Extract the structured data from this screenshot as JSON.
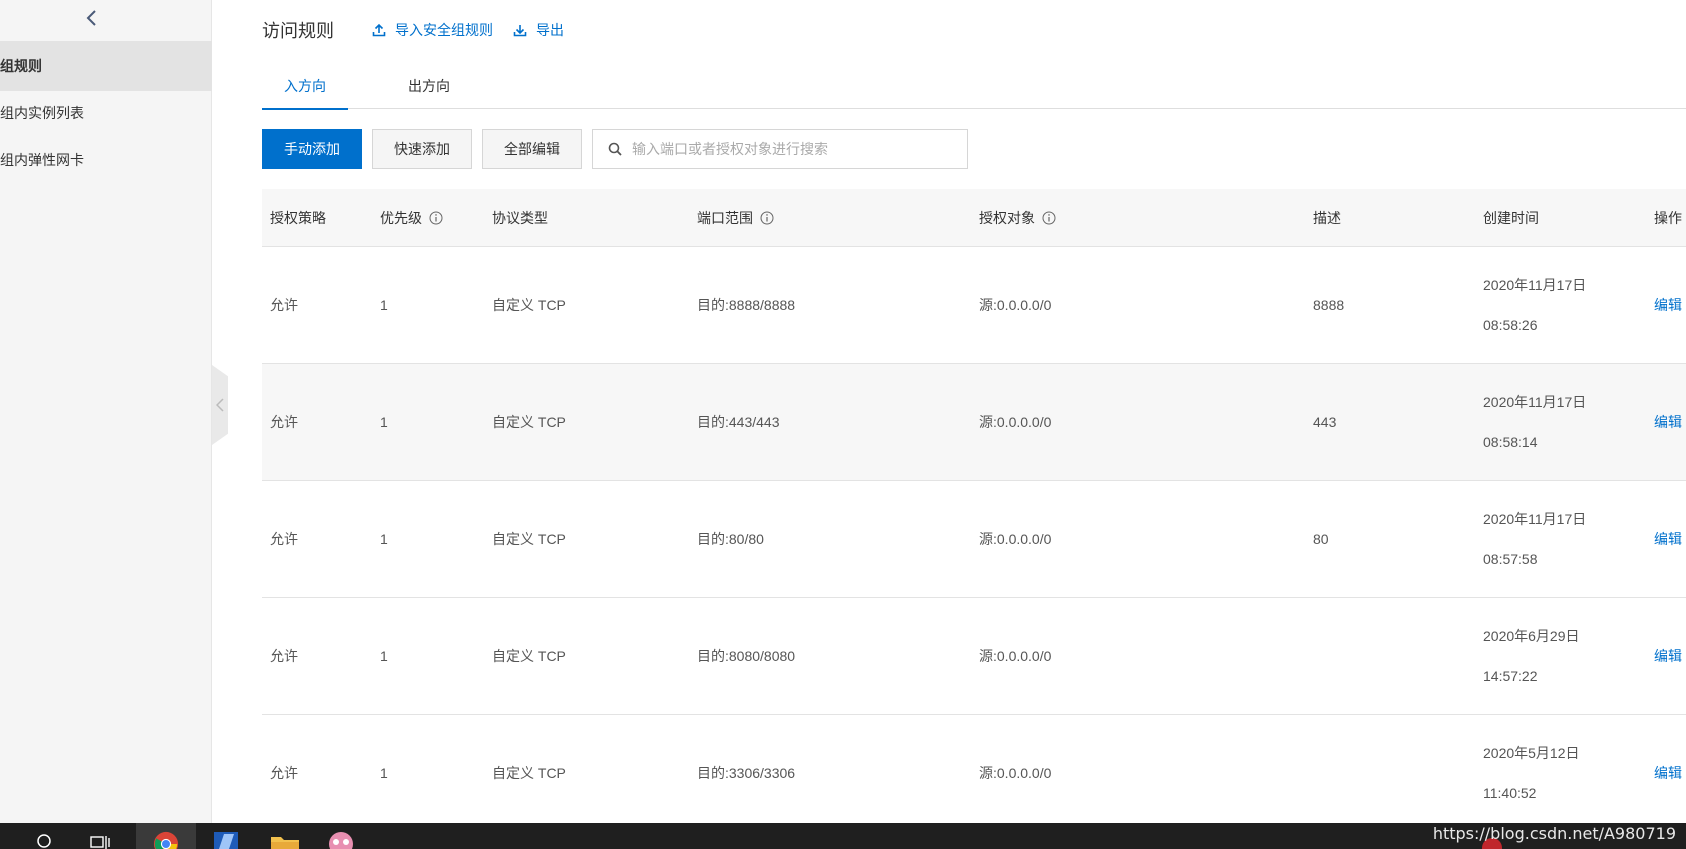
{
  "sidebar": {
    "items": [
      {
        "label": "全组规则"
      },
      {
        "label": "全组内实例列表"
      },
      {
        "label": "全组内弹性网卡"
      }
    ]
  },
  "header": {
    "title": "访问规则",
    "import_label": "导入安全组规则",
    "export_label": "导出"
  },
  "tabs": [
    {
      "label": "入方向"
    },
    {
      "label": "出方向"
    }
  ],
  "toolbar": {
    "manual_add": "手动添加",
    "quick_add": "快速添加",
    "edit_all": "全部编辑",
    "search_placeholder": "输入端口或者授权对象进行搜索"
  },
  "table": {
    "columns": [
      "授权策略",
      "优先级",
      "协议类型",
      "端口范围",
      "授权对象",
      "描述",
      "创建时间",
      "操作"
    ],
    "rows": [
      {
        "policy": "允许",
        "priority": "1",
        "protocol": "自定义 TCP",
        "port": "目的:8888/8888",
        "source": "源:0.0.0.0/0",
        "desc": "8888",
        "date": "2020年11月17日",
        "time": "08:58:26",
        "op": "编辑"
      },
      {
        "policy": "允许",
        "priority": "1",
        "protocol": "自定义 TCP",
        "port": "目的:443/443",
        "source": "源:0.0.0.0/0",
        "desc": "443",
        "date": "2020年11月17日",
        "time": "08:58:14",
        "op": "编辑"
      },
      {
        "policy": "允许",
        "priority": "1",
        "protocol": "自定义 TCP",
        "port": "目的:80/80",
        "source": "源:0.0.0.0/0",
        "desc": "80",
        "date": "2020年11月17日",
        "time": "08:57:58",
        "op": "编辑"
      },
      {
        "policy": "允许",
        "priority": "1",
        "protocol": "自定义 TCP",
        "port": "目的:8080/8080",
        "source": "源:0.0.0.0/0",
        "desc": "",
        "date": "2020年6月29日",
        "time": "14:57:22",
        "op": "编辑"
      },
      {
        "policy": "允许",
        "priority": "1",
        "protocol": "自定义 TCP",
        "port": "目的:3306/3306",
        "source": "源:0.0.0.0/0",
        "desc": "",
        "date": "2020年5月12日",
        "time": "11:40:52",
        "op": "编辑"
      }
    ]
  },
  "taskbar": {
    "watermark": "https://blog.csdn.net/A980719"
  },
  "colors": {
    "accent": "#0070cc",
    "sidebar_bg": "#f5f5f5",
    "taskbar_bg": "#1f1f1f"
  }
}
